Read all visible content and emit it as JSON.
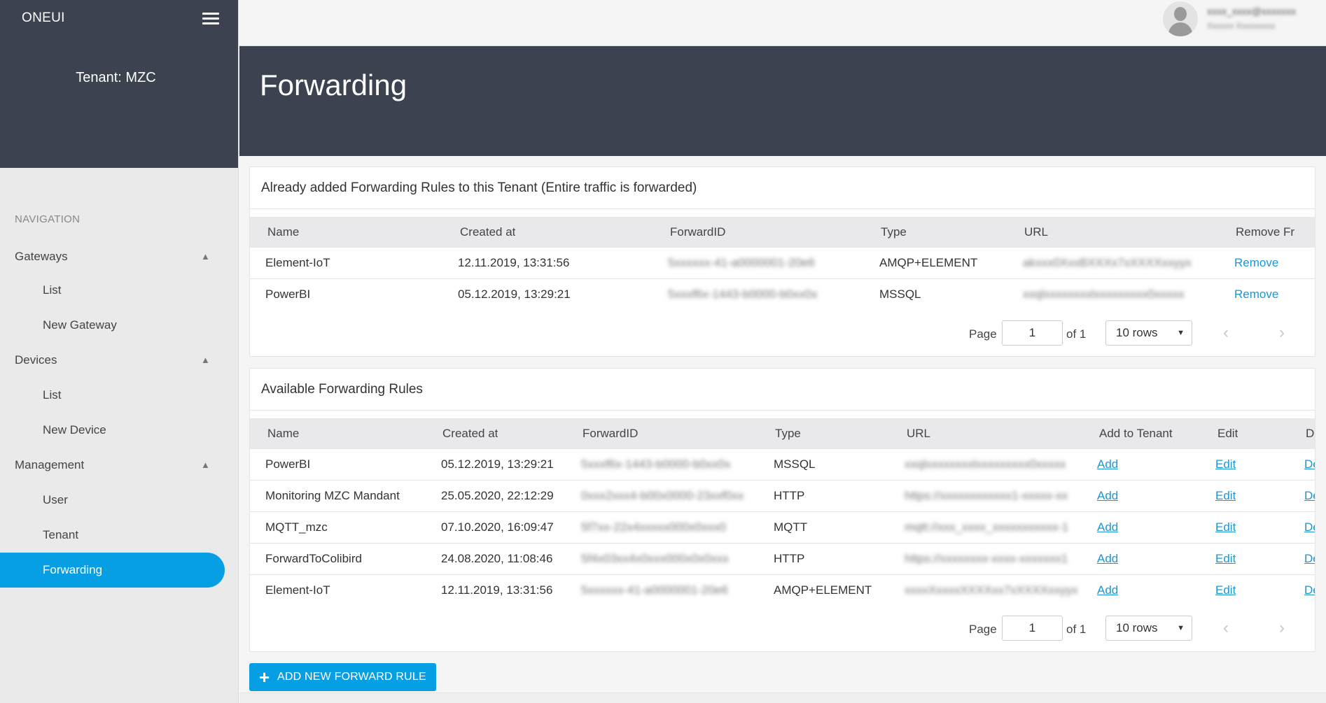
{
  "sidebar": {
    "brand": "ONEUI",
    "tenant_title": "Tenant: MZC",
    "nav_heading": "NAVIGATION",
    "groups": [
      {
        "label": "Gateways",
        "items": [
          "List",
          "New Gateway"
        ]
      },
      {
        "label": "Devices",
        "items": [
          "List",
          "New Device"
        ]
      },
      {
        "label": "Management",
        "items": [
          "User",
          "Tenant",
          "Forwarding"
        ]
      }
    ],
    "active_item": "Forwarding",
    "icons": {
      "menu": "hamburger-icon",
      "collapse": "chevron-up-icon"
    }
  },
  "topbar": {
    "user_name": "xxxx_xxxx@xxxxxxx",
    "user_sub": "Xxxxxx Xxxxxxxxx",
    "avatar_icon": "user-avatar-icon"
  },
  "hero": {
    "title": "Forwarding"
  },
  "added_rules": {
    "title": "Already added Forwarding Rules to this Tenant (Entire traffic is forwarded)",
    "columns": [
      "Name",
      "Created at",
      "ForwardID",
      "Type",
      "URL",
      "Remove Fr"
    ],
    "rows": [
      {
        "name": "Element-IoT",
        "created": "12.11.2019, 13:31:56",
        "forward_id": "5xxxxxx-41-a0000001-20e6",
        "type": "AMQP+ELEMENT",
        "url": "akxxx0XxxBXXXx7xXXXXxxyyx",
        "action": "Remove"
      },
      {
        "name": "PowerBI",
        "created": "05.12.2019, 13:29:21",
        "forward_id": "5xxxf6x-1443-b0000-b0xx0x",
        "type": "MSSQL",
        "url": "xxqlxxxxxxxxlxxxxxxxxx0xxxxx",
        "action": "Remove"
      }
    ],
    "pager": {
      "page_label": "Page",
      "page_value": "1",
      "of_label": "of 1",
      "rows_label": "10 rows"
    }
  },
  "available_rules": {
    "title": "Available Forwarding Rules",
    "columns": [
      "Name",
      "Created at",
      "ForwardID",
      "Type",
      "URL",
      "Add to Tenant",
      "Edit",
      "De"
    ],
    "rows": [
      {
        "name": "PowerBI",
        "created": "05.12.2019, 13:29:21",
        "forward_id": "5xxxf6x-1443-b0000-b0xx0x",
        "type": "MSSQL",
        "url": "xxqlxxxxxxxxlxxxxxxxxx0xxxxx",
        "add": "Add",
        "edit": "Edit",
        "del": "De"
      },
      {
        "name": "Monitoring MZC Mandant",
        "created": "25.05.2020, 22:12:29",
        "forward_id": "0xxx2xxx4-b00x0000-23xxf0xx",
        "type": "HTTP",
        "url": "https://xxxxxxxxxxxx1-xxxxx-xx",
        "add": "Add",
        "edit": "Edit",
        "del": "De"
      },
      {
        "name": "MQTT_mzc",
        "created": "07.10.2020, 16:09:47",
        "forward_id": "5f7xx-22x4xxxxx000x0xxx0",
        "type": "MQTT",
        "url": "mqtt://xxx_xxxx_xxxxxxxxxxx-1",
        "add": "Add",
        "edit": "Edit",
        "del": "De"
      },
      {
        "name": "ForwardToColibird",
        "created": "24.08.2020, 11:08:46",
        "forward_id": "5f4x03xx4x0xxx000x0x0xxx",
        "type": "HTTP",
        "url": "https://xxxxxxxx-xxxx-xxxxxxx1",
        "add": "Add",
        "edit": "Edit",
        "del": "De"
      },
      {
        "name": "Element-IoT",
        "created": "12.11.2019, 13:31:56",
        "forward_id": "5xxxxxx-41-a0000001-20e6",
        "type": "AMQP+ELEMENT",
        "url": "xxxxXxxxxXXXXxx7xXXXXxxyyx",
        "add": "Add",
        "edit": "Edit",
        "del": "De"
      }
    ],
    "pager": {
      "page_label": "Page",
      "page_value": "1",
      "of_label": "of 1",
      "rows_label": "10 rows"
    }
  },
  "add_button": {
    "label": "ADD NEW FORWARD RULE",
    "icon": "plus-icon"
  },
  "colors": {
    "sidebar_dark": "#3d4250",
    "accent": "#079fe4",
    "link": "#1a97d4"
  }
}
